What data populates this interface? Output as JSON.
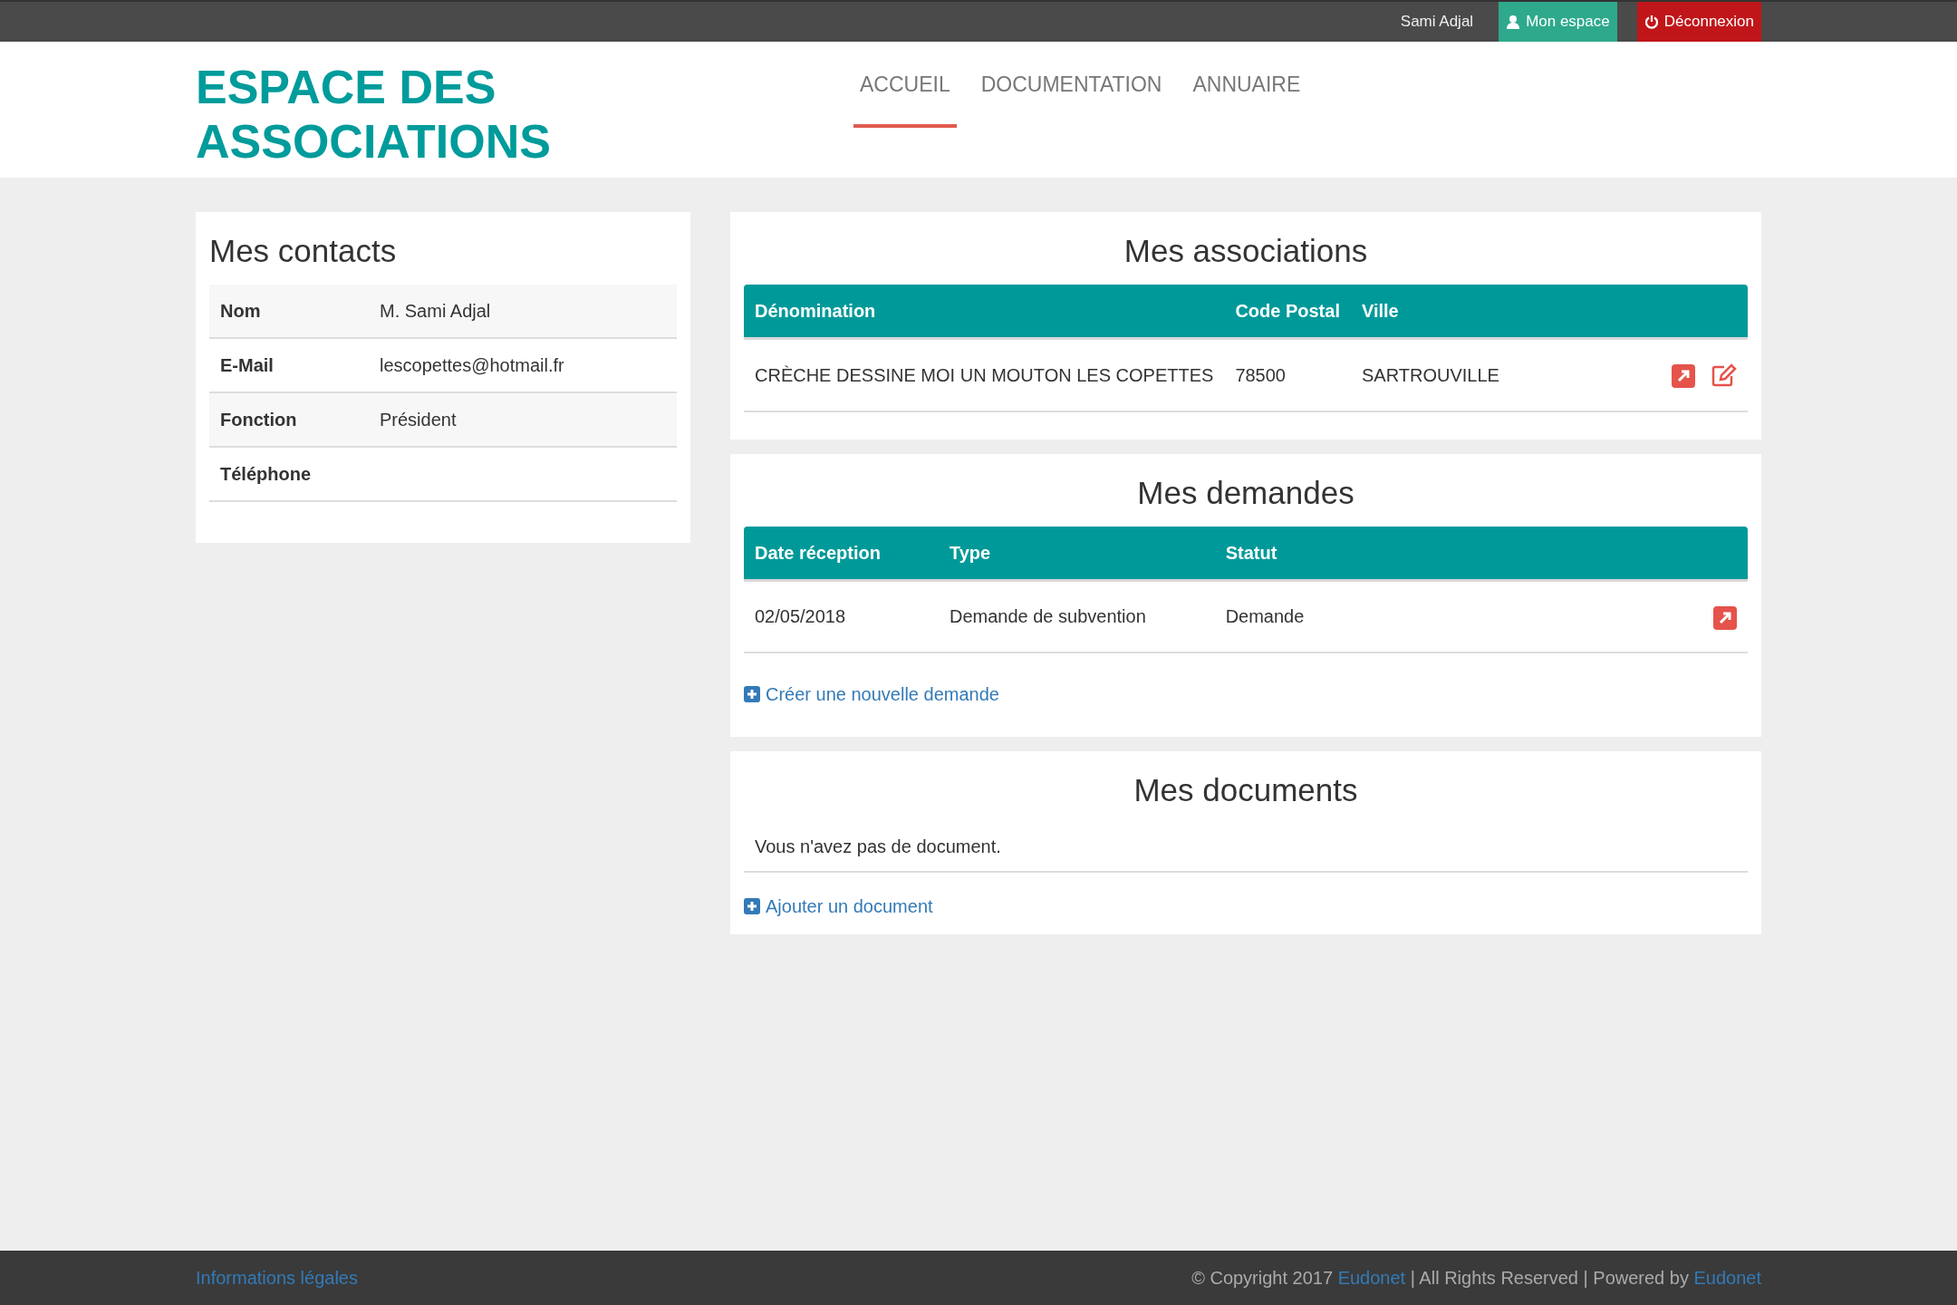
{
  "topbar": {
    "user": "Sami Adjal",
    "buttons": [
      {
        "kind": "space",
        "label": "Mon espace"
      },
      {
        "kind": "logout",
        "label": "Déconnexion"
      }
    ]
  },
  "header": {
    "title_lines": [
      "ESPACE DES",
      "ASSOCIATIONS"
    ],
    "nav": [
      {
        "label": "ACCUEIL",
        "selected": true
      },
      {
        "label": "DOCUMENTATION",
        "selected": false
      },
      {
        "label": "ANNUAIRE",
        "selected": false
      }
    ]
  },
  "contacts": {
    "title": "Mes contacts",
    "rows": [
      {
        "label": "Nom",
        "value": "M. Sami Adjal"
      },
      {
        "label": "E-Mail",
        "value": "lescopettes@hotmail.fr"
      },
      {
        "label": "Fonction",
        "value": "Président"
      },
      {
        "label": "Téléphone"
      }
    ]
  },
  "associations": {
    "title": "Mes associations",
    "columns": [
      "Dénomination",
      "Code Postal",
      "Ville"
    ],
    "rows": [
      {
        "cells": [
          "CRÈCHE DESSINE MOI UN MOUTON LES COPETTES",
          "78500",
          "SARTROUVILLE"
        ],
        "actions": [
          {
            "kind": "open"
          },
          {
            "kind": "edit"
          }
        ]
      }
    ]
  },
  "demandes": {
    "title": "Mes demandes",
    "columns": [
      "Date réception",
      "Type",
      "Statut"
    ],
    "rows": [
      {
        "cells": [
          "02/05/2018",
          "Demande de subvention",
          "Demande"
        ],
        "actions": [
          {
            "kind": "open"
          }
        ]
      }
    ],
    "add_link": "Créer une nouvelle demande"
  },
  "documents": {
    "title": "Mes documents",
    "empty_text": "Vous n'avez pas de document.",
    "add_link": "Ajouter un document"
  },
  "footer": {
    "legal_link": "Informations légales",
    "copyright": [
      {
        "kind": "text",
        "text": "© Copyright 2017"
      },
      {
        "kind": "link",
        "text": "Eudonet"
      },
      {
        "kind": "text",
        "text": "| All Rights Reserved | Powered by"
      },
      {
        "kind": "link",
        "text": "Eudonet"
      }
    ]
  }
}
